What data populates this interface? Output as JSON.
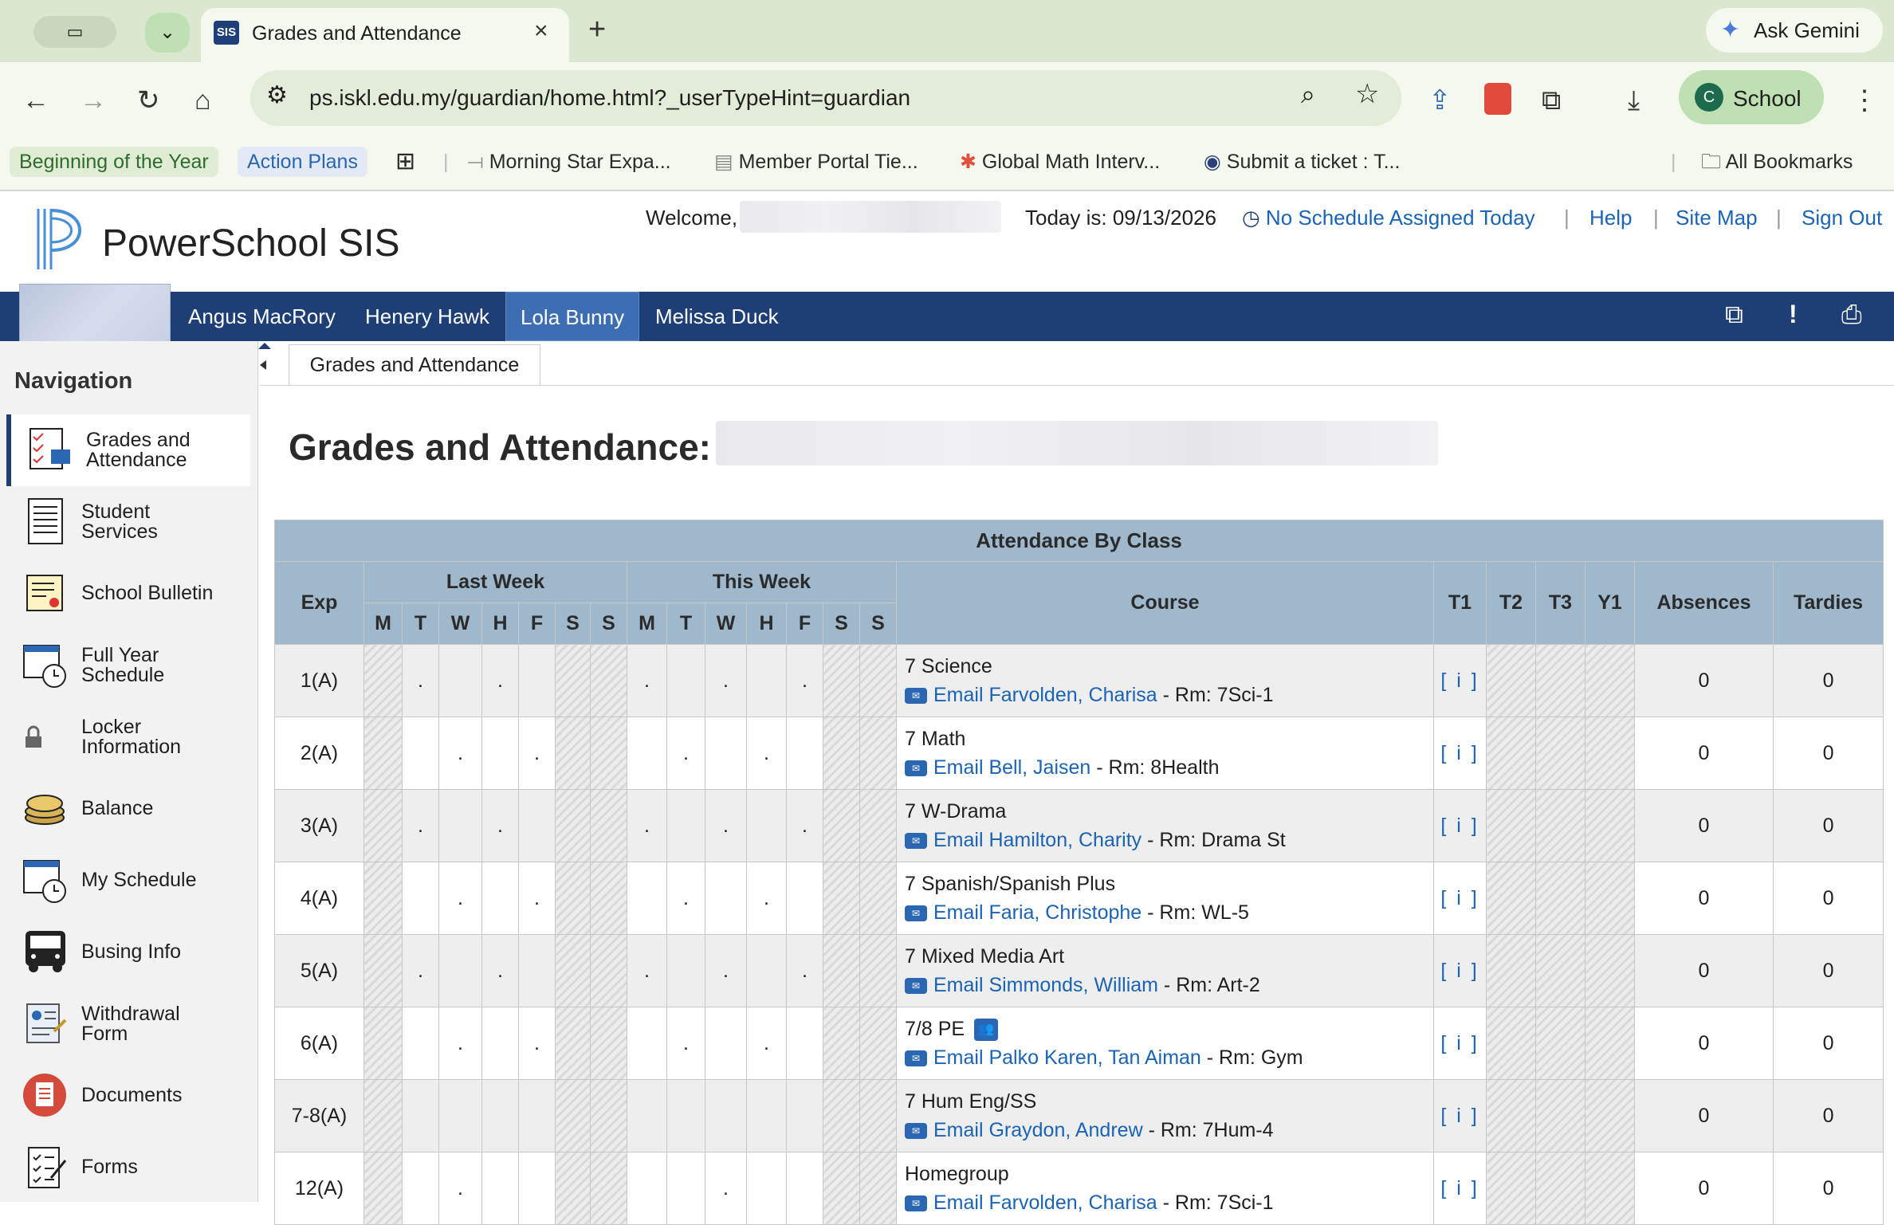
{
  "browser": {
    "tab_title": "Grades and Attendance",
    "tab_favicon": "SIS",
    "gemini_label": "Ask Gemini",
    "url": "ps.iskl.edu.my/guardian/home.html?_userTypeHint=guardian",
    "profile_initial": "C",
    "profile_label": "School",
    "bookmarks": [
      "Beginning of the Year",
      "Action Plans",
      "Morning Star Expa...",
      "Member Portal Tie...",
      "Global Math Interv...",
      "Submit a ticket : T...",
      "All Bookmarks"
    ]
  },
  "header": {
    "app_name": "PowerSchool SIS",
    "welcome": "Welcome,",
    "today": "Today is: 09/13/2026",
    "schedule": "No Schedule Assigned Today",
    "help": "Help",
    "site_map": "Site Map",
    "sign_out": "Sign Out"
  },
  "students": [
    "Angus MacRory",
    "Henery Hawk",
    "Lola Bunny",
    "Melissa Duck"
  ],
  "active_student": "Lola Bunny",
  "nav": {
    "title": "Navigation",
    "items": [
      {
        "label": "Grades and Attendance",
        "l1": "Grades and",
        "l2": "Attendance",
        "icon": "grades-icon"
      },
      {
        "label": "Student Services",
        "l1": "Student",
        "l2": "Services",
        "icon": "services-icon"
      },
      {
        "label": "School Bulletin",
        "l1": "School Bulletin",
        "l2": "",
        "icon": "bulletin-icon"
      },
      {
        "label": "Full Year Schedule",
        "l1": "Full Year",
        "l2": "Schedule",
        "icon": "calendar-clock-icon"
      },
      {
        "label": "Locker Information",
        "l1": "Locker",
        "l2": "Information",
        "icon": "lock-icon"
      },
      {
        "label": "Balance",
        "l1": "Balance",
        "l2": "",
        "icon": "coins-icon"
      },
      {
        "label": "My Schedule",
        "l1": "My Schedule",
        "l2": "",
        "icon": "calendar-clock-icon"
      },
      {
        "label": "Busing Info",
        "l1": "Busing Info",
        "l2": "",
        "icon": "bus-icon"
      },
      {
        "label": "Withdrawal Form",
        "l1": "Withdrawal",
        "l2": "Form",
        "icon": "form-icon"
      },
      {
        "label": "Documents",
        "l1": "Documents",
        "l2": "",
        "icon": "documents-icon"
      },
      {
        "label": "Forms",
        "l1": "Forms",
        "l2": "",
        "icon": "forms-icon"
      }
    ]
  },
  "content": {
    "tab": "Grades and Attendance",
    "title": "Grades and Attendance:"
  },
  "table": {
    "caption": "Attendance By Class",
    "headers": {
      "exp": "Exp",
      "last_week": "Last Week",
      "this_week": "This Week",
      "course": "Course",
      "t1": "T1",
      "t2": "T2",
      "t3": "T3",
      "y1": "Y1",
      "absences": "Absences",
      "tardies": "Tardies"
    },
    "days": [
      "M",
      "T",
      "W",
      "H",
      "F",
      "S",
      "S"
    ],
    "rows": [
      {
        "exp": "1(A)",
        "course": "7 Science",
        "email": "Email Farvolden, Charisa",
        "room": " - Rm: 7Sci-1",
        "t1": "[ i ]",
        "abs": "0",
        "tar": "0",
        "group": false,
        "last": [
          "",
          ".",
          "",
          ".",
          "",
          "",
          ""
        ],
        "this": [
          ".",
          "",
          ".",
          "",
          ".",
          "",
          ""
        ]
      },
      {
        "exp": "2(A)",
        "course": "7 Math",
        "email": "Email Bell, Jaisen",
        "room": " - Rm: 8Health",
        "t1": "[ i ]",
        "abs": "0",
        "tar": "0",
        "group": false,
        "last": [
          "",
          "",
          ".",
          "",
          ".",
          "",
          ""
        ],
        "this": [
          "",
          ".",
          "",
          ".",
          "",
          "",
          ""
        ]
      },
      {
        "exp": "3(A)",
        "course": "7 W-Drama",
        "email": "Email Hamilton, Charity",
        "room": " - Rm: Drama St",
        "t1": "[ i ]",
        "abs": "0",
        "tar": "0",
        "group": false,
        "last": [
          "",
          ".",
          "",
          ".",
          "",
          "",
          ""
        ],
        "this": [
          ".",
          "",
          ".",
          "",
          ".",
          "",
          ""
        ]
      },
      {
        "exp": "4(A)",
        "course": "7 Spanish/Spanish Plus",
        "email": "Email Faria, Christophe",
        "room": " - Rm: WL-5",
        "t1": "[ i ]",
        "abs": "0",
        "tar": "0",
        "group": false,
        "last": [
          "",
          "",
          ".",
          "",
          ".",
          "",
          ""
        ],
        "this": [
          "",
          ".",
          "",
          ".",
          "",
          "",
          ""
        ]
      },
      {
        "exp": "5(A)",
        "course": "7 Mixed Media Art",
        "email": "Email Simmonds, William",
        "room": " - Rm: Art-2",
        "t1": "[ i ]",
        "abs": "0",
        "tar": "0",
        "group": false,
        "last": [
          "",
          ".",
          "",
          ".",
          "",
          "",
          ""
        ],
        "this": [
          ".",
          "",
          ".",
          "",
          ".",
          "",
          ""
        ]
      },
      {
        "exp": "6(A)",
        "course": "7/8 PE",
        "email": "Email Palko Karen, Tan Aiman",
        "room": " - Rm: Gym",
        "t1": "[ i ]",
        "abs": "0",
        "tar": "0",
        "group": true,
        "last": [
          "",
          "",
          ".",
          "",
          ".",
          "",
          ""
        ],
        "this": [
          "",
          ".",
          "",
          ".",
          "",
          "",
          ""
        ]
      },
      {
        "exp": "7-8(A)",
        "course": "7 Hum Eng/SS",
        "email": "Email Graydon, Andrew",
        "room": " - Rm: 7Hum-4",
        "t1": "[ i ]",
        "abs": "0",
        "tar": "0",
        "group": false,
        "last": [
          "",
          "",
          "",
          "",
          "",
          "",
          ""
        ],
        "this": [
          "",
          "",
          "",
          "",
          "",
          "",
          ""
        ]
      },
      {
        "exp": "12(A)",
        "course": "Homegroup",
        "email": "Email Farvolden, Charisa",
        "room": " - Rm: 7Sci-1",
        "t1": "[ i ]",
        "abs": "0",
        "tar": "0",
        "group": false,
        "last": [
          "",
          "",
          ".",
          "",
          "",
          "",
          ""
        ],
        "this": [
          "",
          "",
          ".",
          "",
          "",
          "",
          ""
        ]
      }
    ]
  },
  "colors": {
    "nav_blue": "#1d3f75",
    "header_blue": "#9fb8cc",
    "link": "#1a63b5"
  }
}
